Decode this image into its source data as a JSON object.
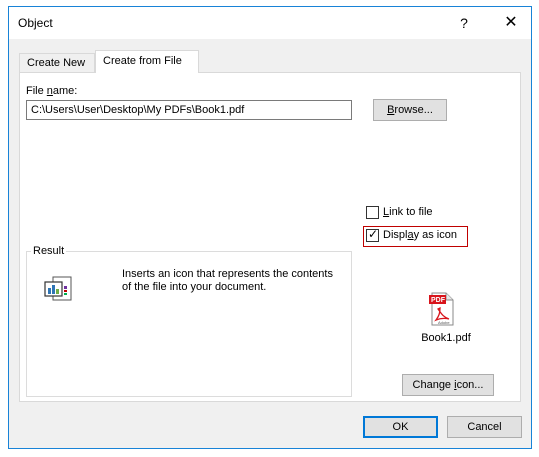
{
  "window": {
    "title": "Object",
    "help_glyph": "?",
    "close_glyph": "✕"
  },
  "tabs": [
    {
      "label": "Create New",
      "selected": false
    },
    {
      "label": "Create from File",
      "selected": true
    }
  ],
  "file": {
    "label_prefix": "File ",
    "label_accel": "n",
    "label_suffix": "ame:",
    "value": "C:\\Users\\User\\Desktop\\My PDFs\\Book1.pdf",
    "browse_prefix": "",
    "browse_accel": "B",
    "browse_suffix": "rowse..."
  },
  "options": {
    "link_accel": "L",
    "link_suffix": "ink to file",
    "link_checked": false,
    "display_prefix": "Displ",
    "display_accel": "a",
    "display_suffix": "y as icon",
    "display_checked": true,
    "checkmark": "✓"
  },
  "result": {
    "title": "Result",
    "text": "Inserts an icon that represents the contents of the file into your document."
  },
  "icon_preview": {
    "badge": "PDF",
    "brand": "Adobe",
    "caption": "Book1.pdf",
    "change_prefix": "Change ",
    "change_accel": "i",
    "change_suffix": "con..."
  },
  "footer": {
    "ok_label": "OK",
    "cancel_label": "Cancel"
  },
  "colors": {
    "window_border": "#1883d7",
    "highlight": "#c00000",
    "pdf_red": "#d8141b"
  }
}
